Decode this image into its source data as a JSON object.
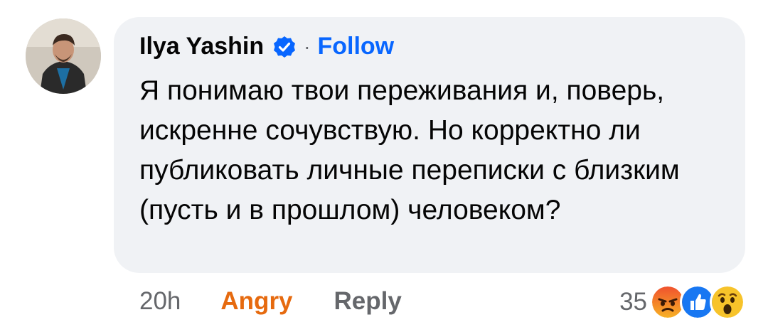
{
  "comment": {
    "author": "Ilya Yashin",
    "verified_icon": "verified-badge-icon",
    "separator": "·",
    "follow_label": "Follow",
    "text": "Я понимаю твои переживания и, поверь, искренне сочувствую. Но корректно ли публиковать личные переписки с близким (пусть и в прошлом) человеком?"
  },
  "meta": {
    "time": "20h",
    "reaction_label": "Angry",
    "reply_label": "Reply"
  },
  "reactions": {
    "count": "35",
    "icons": [
      "angry-emoji-icon",
      "like-icon",
      "wow-emoji-icon"
    ]
  },
  "colors": {
    "bubble": "#f0f2f5",
    "link_blue": "#0866ff",
    "angry_orange": "#e66a0f",
    "meta_gray": "#65676b"
  }
}
